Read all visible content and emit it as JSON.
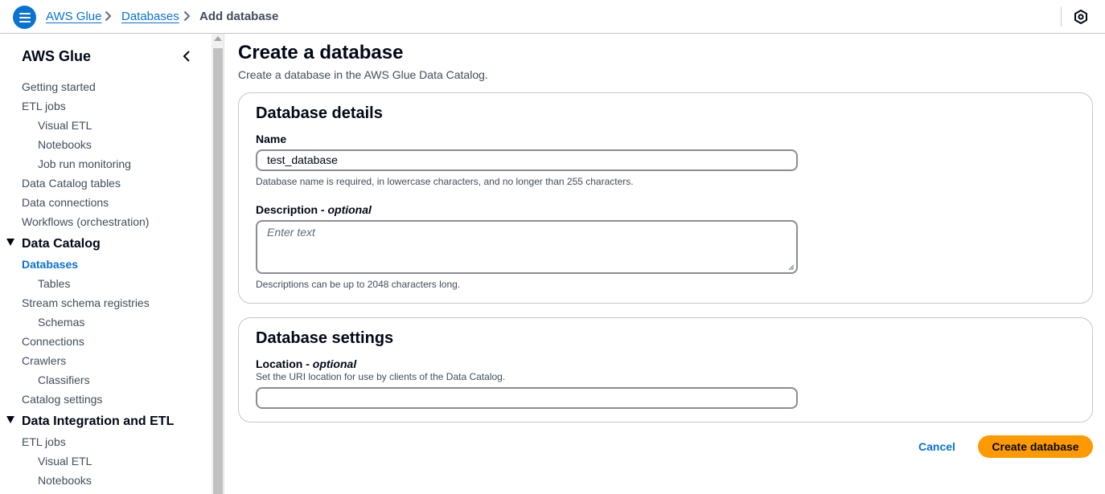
{
  "header": {
    "breadcrumbs": [
      "AWS Glue",
      "Databases",
      "Add database"
    ],
    "menu_icon": "hamburger-icon",
    "settings_icon": "settings-hexagon-icon"
  },
  "sidebar": {
    "title": "AWS Glue",
    "items": [
      {
        "label": "Getting started",
        "level": 1
      },
      {
        "label": "ETL jobs",
        "level": 1
      },
      {
        "label": "Visual ETL",
        "level": 2
      },
      {
        "label": "Notebooks",
        "level": 2
      },
      {
        "label": "Job run monitoring",
        "level": 2
      },
      {
        "label": "Data Catalog tables",
        "level": 1
      },
      {
        "label": "Data connections",
        "level": 1
      },
      {
        "label": "Workflows (orchestration)",
        "level": 1
      }
    ],
    "section_data_catalog": "Data Catalog",
    "data_catalog_items": [
      {
        "label": "Databases",
        "level": 1,
        "active": true
      },
      {
        "label": "Tables",
        "level": 2
      },
      {
        "label": "Stream schema registries",
        "level": 1
      },
      {
        "label": "Schemas",
        "level": 2
      },
      {
        "label": "Connections",
        "level": 1
      },
      {
        "label": "Crawlers",
        "level": 1
      },
      {
        "label": "Classifiers",
        "level": 2
      },
      {
        "label": "Catalog settings",
        "level": 1
      }
    ],
    "section_integration": "Data Integration and ETL",
    "integration_items": [
      {
        "label": "ETL jobs",
        "level": 1
      },
      {
        "label": "Visual ETL",
        "level": 2
      },
      {
        "label": "Notebooks",
        "level": 2
      }
    ]
  },
  "main": {
    "title": "Create a database",
    "description": "Create a database in the AWS Glue Data Catalog.",
    "details": {
      "title": "Database details",
      "name_label": "Name",
      "name_value": "test_database",
      "name_hint": "Database name is required, in lowercase characters, and no longer than 255 characters.",
      "desc_label": "Description - ",
      "desc_optional": "optional",
      "desc_placeholder": "Enter text",
      "desc_hint": "Descriptions can be up to 2048 characters long."
    },
    "settings": {
      "title": "Database settings",
      "location_label": "Location - ",
      "location_optional": "optional",
      "location_hint": "Set the URI location for use by clients of the Data Catalog.",
      "location_value": ""
    },
    "actions": {
      "cancel": "Cancel",
      "create": "Create database"
    }
  },
  "colors": {
    "link": "#0972d3",
    "primary_button": "#ff9900",
    "text": "#000716",
    "secondary_text": "#414d5c",
    "border": "#c6c6cd"
  }
}
